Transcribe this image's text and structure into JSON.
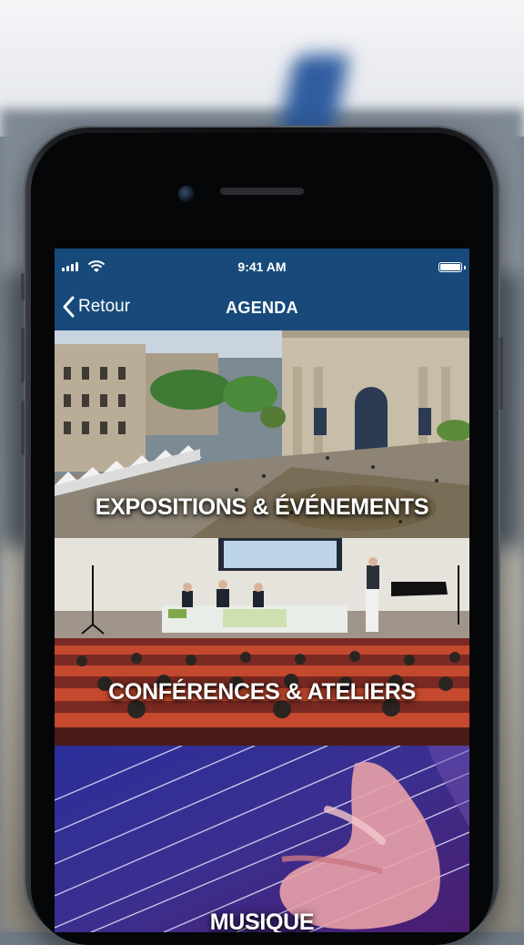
{
  "status_bar": {
    "time": "9:41 AM"
  },
  "nav": {
    "back_label": "Retour",
    "title": "AGENDA"
  },
  "tiles": [
    {
      "label": "EXPOSITIONS & ÉVÉNEMENTS"
    },
    {
      "label": "CONFÉRENCES & ATELIERS"
    },
    {
      "label": "MUSIQUE"
    }
  ],
  "colors": {
    "nav_background": "#174a7a",
    "text": "#ffffff"
  },
  "icons": {
    "back": "chevron-left-icon",
    "wifi": "wifi-icon",
    "signal": "signal-icon",
    "battery": "battery-icon"
  }
}
